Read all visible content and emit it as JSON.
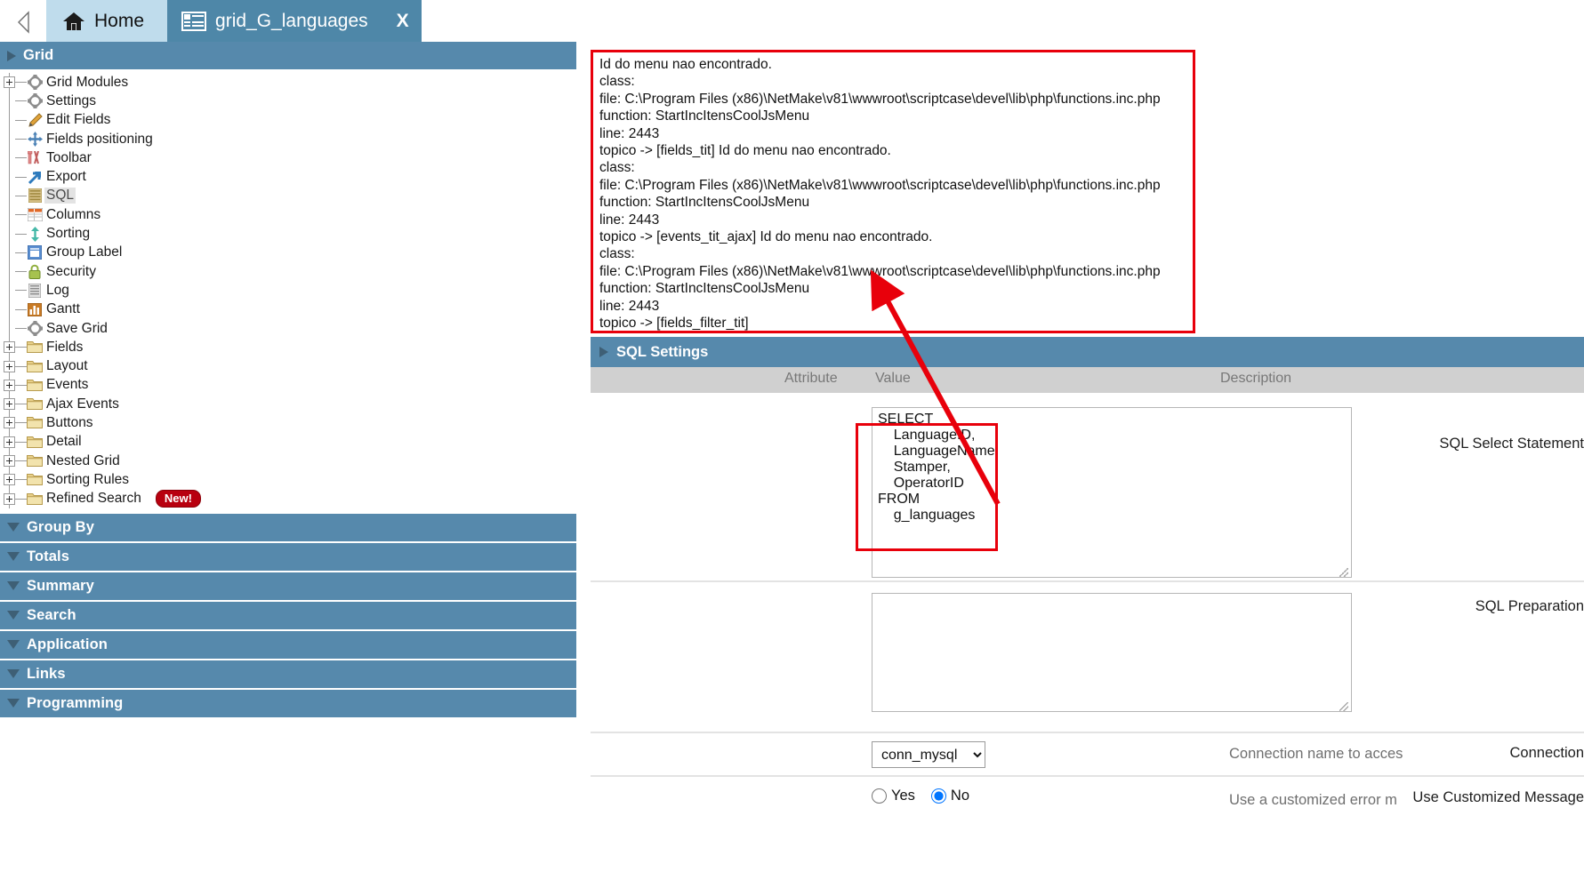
{
  "tabbar": {
    "back_icon": "triangle-left-icon",
    "tabs": [
      {
        "label": "Home",
        "icon": "home-icon",
        "active": false
      },
      {
        "label": "grid_G_languages",
        "icon": "grid-icon",
        "active": true,
        "close": "X"
      }
    ]
  },
  "sidebar": {
    "groups": [
      {
        "label": "Grid",
        "state": "expanded",
        "arrow": "arrow-right"
      },
      {
        "label": "Group By",
        "state": "collapsed",
        "arrow": "arrow-down"
      },
      {
        "label": "Totals",
        "state": "collapsed",
        "arrow": "arrow-down"
      },
      {
        "label": "Summary",
        "state": "collapsed",
        "arrow": "arrow-down"
      },
      {
        "label": "Search",
        "state": "collapsed",
        "arrow": "arrow-down"
      },
      {
        "label": "Application",
        "state": "collapsed",
        "arrow": "arrow-down"
      },
      {
        "label": "Links",
        "state": "collapsed",
        "arrow": "arrow-down"
      },
      {
        "label": "Programming",
        "state": "collapsed",
        "arrow": "arrow-down"
      }
    ],
    "tree": [
      {
        "label": "Grid Modules",
        "icon": "gear-icon",
        "expander": true,
        "selected": false
      },
      {
        "label": "Settings",
        "icon": "gear-icon",
        "expander": false,
        "selected": false
      },
      {
        "label": "Edit Fields",
        "icon": "pencil-icon",
        "expander": false,
        "selected": false
      },
      {
        "label": "Fields positioning",
        "icon": "move-cross-icon",
        "expander": false,
        "selected": false
      },
      {
        "label": "Toolbar",
        "icon": "toolbar-icon",
        "expander": false,
        "selected": false
      },
      {
        "label": "Export",
        "icon": "export-arrow-icon",
        "expander": false,
        "selected": false
      },
      {
        "label": "SQL",
        "icon": "sql-stack-icon",
        "expander": false,
        "selected": true
      },
      {
        "label": "Columns",
        "icon": "columns-icon",
        "expander": false,
        "selected": false
      },
      {
        "label": "Sorting",
        "icon": "sort-updown-icon",
        "expander": false,
        "selected": false
      },
      {
        "label": "Group Label",
        "icon": "group-label-icon",
        "expander": false,
        "selected": false
      },
      {
        "label": "Security",
        "icon": "lock-icon",
        "expander": false,
        "selected": false
      },
      {
        "label": "Log",
        "icon": "log-icon",
        "expander": false,
        "selected": false
      },
      {
        "label": "Gantt",
        "icon": "gantt-chart-icon",
        "expander": false,
        "selected": false
      },
      {
        "label": "Save Grid",
        "icon": "gear-icon",
        "expander": false,
        "selected": false
      },
      {
        "label": "Fields",
        "icon": "folder-icon",
        "expander": true,
        "selected": false
      },
      {
        "label": "Layout",
        "icon": "folder-icon",
        "expander": true,
        "selected": false
      },
      {
        "label": "Events",
        "icon": "folder-icon",
        "expander": true,
        "selected": false
      },
      {
        "label": "Ajax Events",
        "icon": "folder-icon",
        "expander": true,
        "selected": false
      },
      {
        "label": "Buttons",
        "icon": "folder-icon",
        "expander": true,
        "selected": false
      },
      {
        "label": "Detail",
        "icon": "folder-icon",
        "expander": true,
        "selected": false
      },
      {
        "label": "Nested Grid",
        "icon": "folder-icon",
        "expander": true,
        "selected": false
      },
      {
        "label": "Sorting Rules",
        "icon": "folder-icon",
        "expander": true,
        "selected": false
      },
      {
        "label": "Refined Search",
        "icon": "folder-icon",
        "expander": true,
        "selected": false,
        "badge": "New!"
      }
    ]
  },
  "error_panel": {
    "lines": [
      "Id do menu nao encontrado.",
      "class:",
      "file: C:\\Program Files (x86)\\NetMake\\v81\\wwwroot\\scriptcase\\devel\\lib\\php\\functions.inc.php",
      "function: StartIncItensCoolJsMenu",
      "line: 2443",
      "topico -> [fields_tit] Id do menu nao encontrado.",
      "class:",
      "file: C:\\Program Files (x86)\\NetMake\\v81\\wwwroot\\scriptcase\\devel\\lib\\php\\functions.inc.php",
      "function: StartIncItensCoolJsMenu",
      "line: 2443",
      "topico -> [events_tit_ajax] Id do menu nao encontrado.",
      "class:",
      "file: C:\\Program Files (x86)\\NetMake\\v81\\wwwroot\\scriptcase\\devel\\lib\\php\\functions.inc.php",
      "function: StartIncItensCoolJsMenu",
      "line: 2443",
      "topico -> [fields_filter_tit]"
    ]
  },
  "sql_settings": {
    "panel_title": "SQL Settings",
    "columns": {
      "attribute": "Attribute",
      "value": "Value",
      "description": "Description"
    },
    "rows": [
      {
        "label": "SQL Select Statement",
        "type": "textarea",
        "value": "SELECT\n    LanguageID,\n    LanguageName,\n    Stamper,\n    OperatorID\nFROM\n    g_languages",
        "description": ""
      },
      {
        "label": "SQL Preparation",
        "type": "textarea",
        "value": "",
        "description": ""
      },
      {
        "label": "Connection",
        "type": "select",
        "value": "conn_mysql",
        "options": [
          "conn_mysql"
        ],
        "description": "Connection name to acces"
      },
      {
        "label": "Use Customized Message",
        "type": "radio",
        "value": "No",
        "options": [
          "Yes",
          "No"
        ],
        "description": "Use a customized error m"
      }
    ]
  },
  "colors": {
    "panel_blue": "#5689ac",
    "tab_active": "#4e87a8",
    "tab_home": "#bfdcec",
    "annotation_red": "#e8000b",
    "header_gray": "#d0d0d0"
  }
}
